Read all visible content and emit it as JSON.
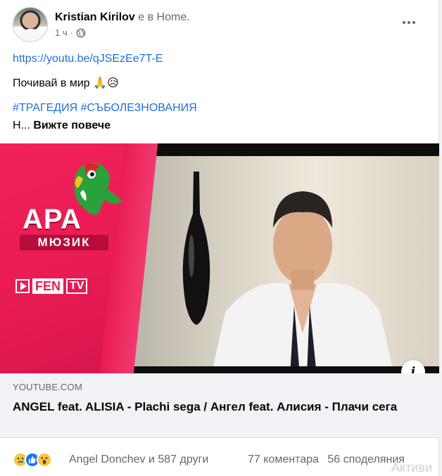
{
  "post": {
    "author": "Kristian Kirilov",
    "location": "е в Home.",
    "time": "1 ч",
    "privacy_icon": "globe-icon",
    "link": "https://youtu.be/qJSEzEe7T-E",
    "message": "Почивай в мир 🙏😥",
    "hashtags": "#ТРАГЕДИЯ #СЪБОЛЕЗНОВАНИЯ",
    "truncated": "Н...",
    "see_more": "Вижте повече"
  },
  "media": {
    "brand": "АРА",
    "brand_sub": "МЮЗИК",
    "channel_fen": "FEN",
    "channel_tv": "TV",
    "info_icon": "i"
  },
  "link_preview": {
    "domain": "YOUTUBE.COM",
    "title": "ANGEL feat. ALISIA - Plachi sega / Ангел feat. Алисия - Плачи сега"
  },
  "footer": {
    "reaction_icons": [
      "sad-icon",
      "like-icon",
      "wow-icon"
    ],
    "reactors": "Angel Donchev и 587 други",
    "comments": "77 коментара",
    "shares": "56 споделяния"
  },
  "overlay": {
    "activate_text": "Активи"
  },
  "colors": {
    "link": "#216fdb",
    "brand_red": "#e91b54",
    "muted": "#65676b"
  }
}
